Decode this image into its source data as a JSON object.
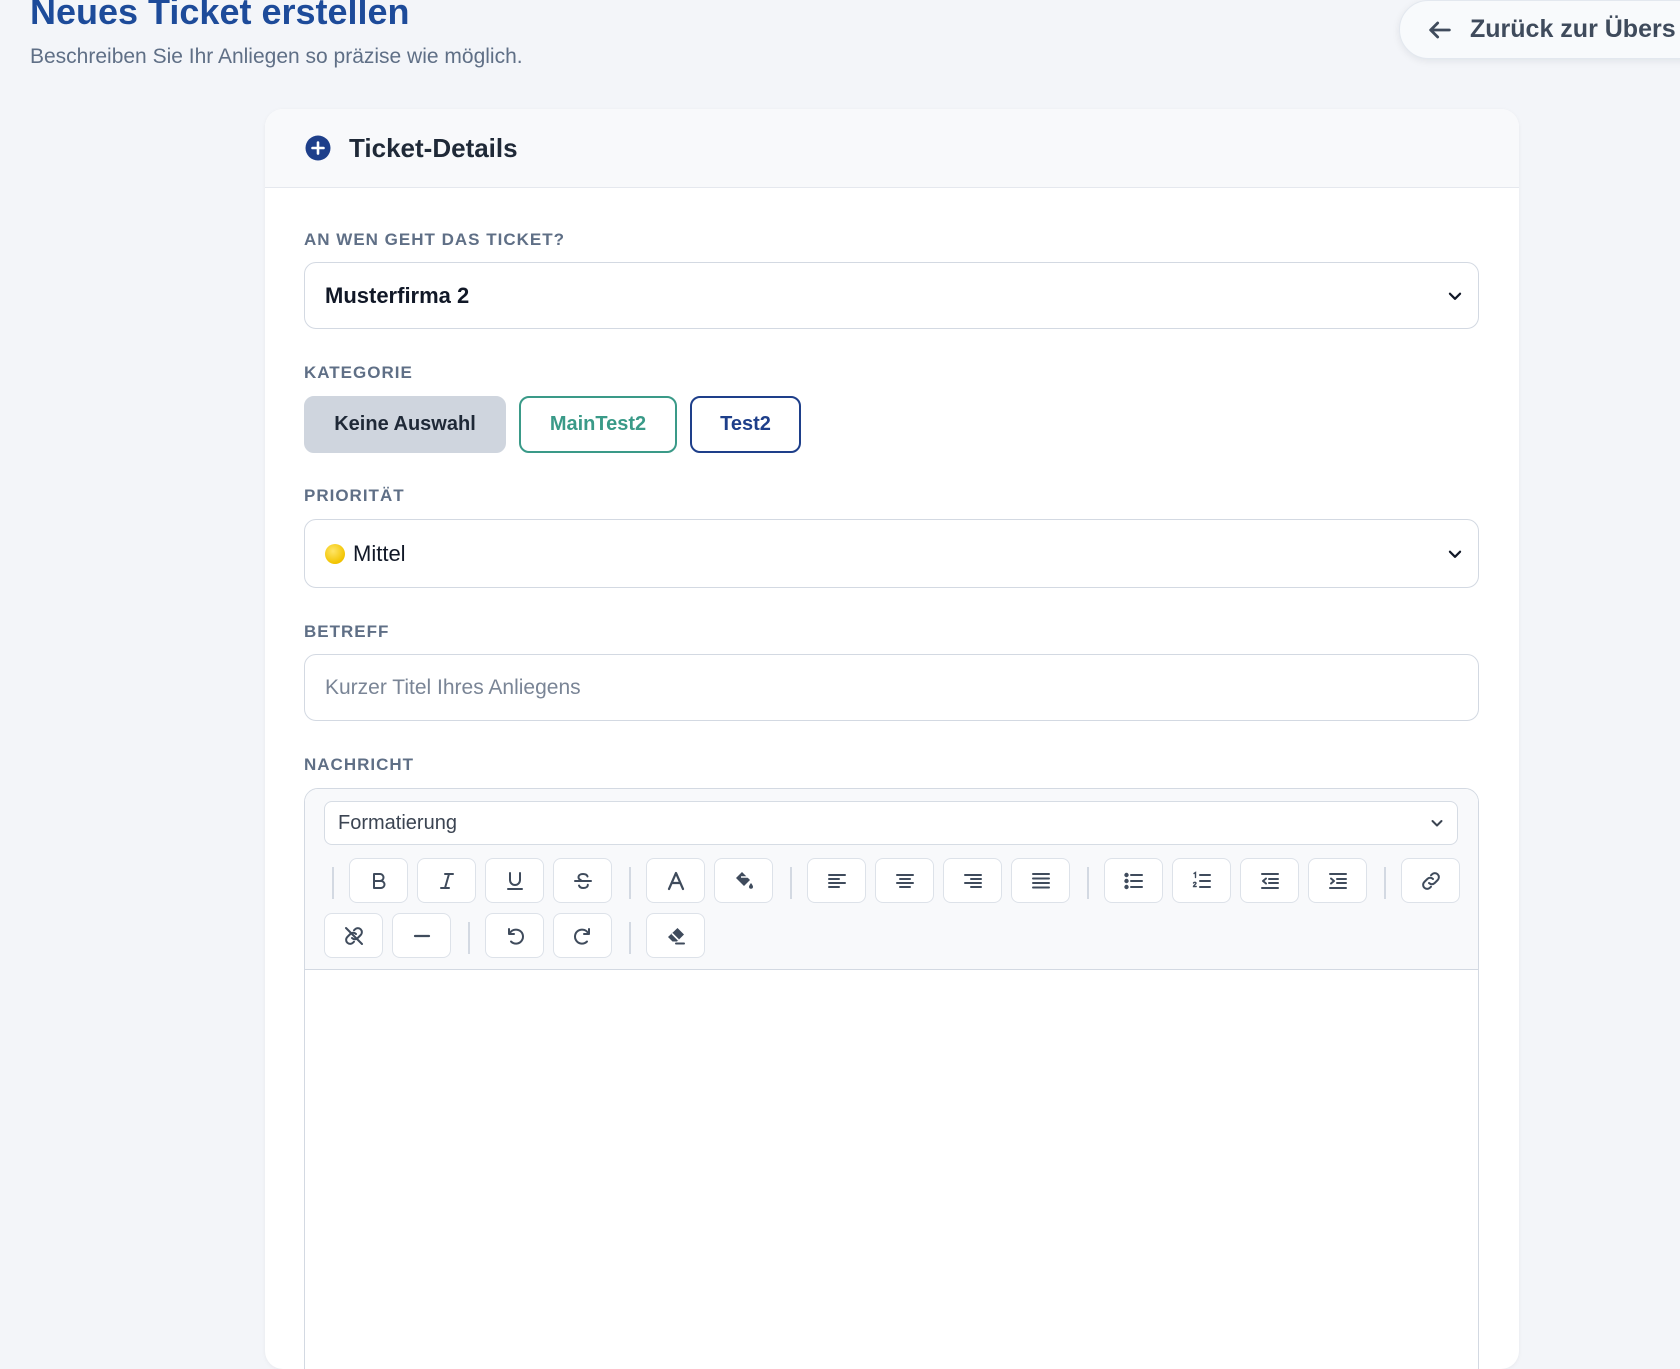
{
  "header": {
    "title": "Neues Ticket erstellen",
    "subtitle": "Beschreiben Sie Ihr Anliegen so präzise wie möglich.",
    "back_label": "Zurück zur Übers"
  },
  "card": {
    "title": "Ticket-Details",
    "recipient": {
      "label": "AN WEN GEHT DAS TICKET?",
      "value": "Musterfirma 2"
    },
    "category": {
      "label": "KATEGORIE",
      "options": [
        "Keine Auswahl",
        "MainTest2",
        "Test2"
      ],
      "selected": "Keine Auswahl"
    },
    "priority": {
      "label": "PRIORITÄT",
      "value": "Mittel",
      "dot_color": "#f5c816"
    },
    "subject": {
      "label": "BETREFF",
      "placeholder": "Kurzer Titel Ihres Anliegens",
      "value": ""
    },
    "message": {
      "label": "NACHRICHT",
      "format_select": "Formatierung",
      "toolbar_icons": [
        "bold-icon",
        "italic-icon",
        "underline-icon",
        "strikethrough-icon",
        "text-color-icon",
        "background-color-icon",
        "align-left-icon",
        "align-center-icon",
        "align-right-icon",
        "align-justify-icon",
        "bullet-list-icon",
        "numbered-list-icon",
        "outdent-icon",
        "indent-icon",
        "link-icon",
        "unlink-icon",
        "horizontal-rule-icon",
        "undo-icon",
        "redo-icon",
        "clear-format-icon"
      ],
      "body": ""
    }
  },
  "colors": {
    "title": "#1d4b9a",
    "category_main": "#3a9a88",
    "category_test": "#1e3f8a",
    "category_none_bg": "#cfd5de"
  }
}
